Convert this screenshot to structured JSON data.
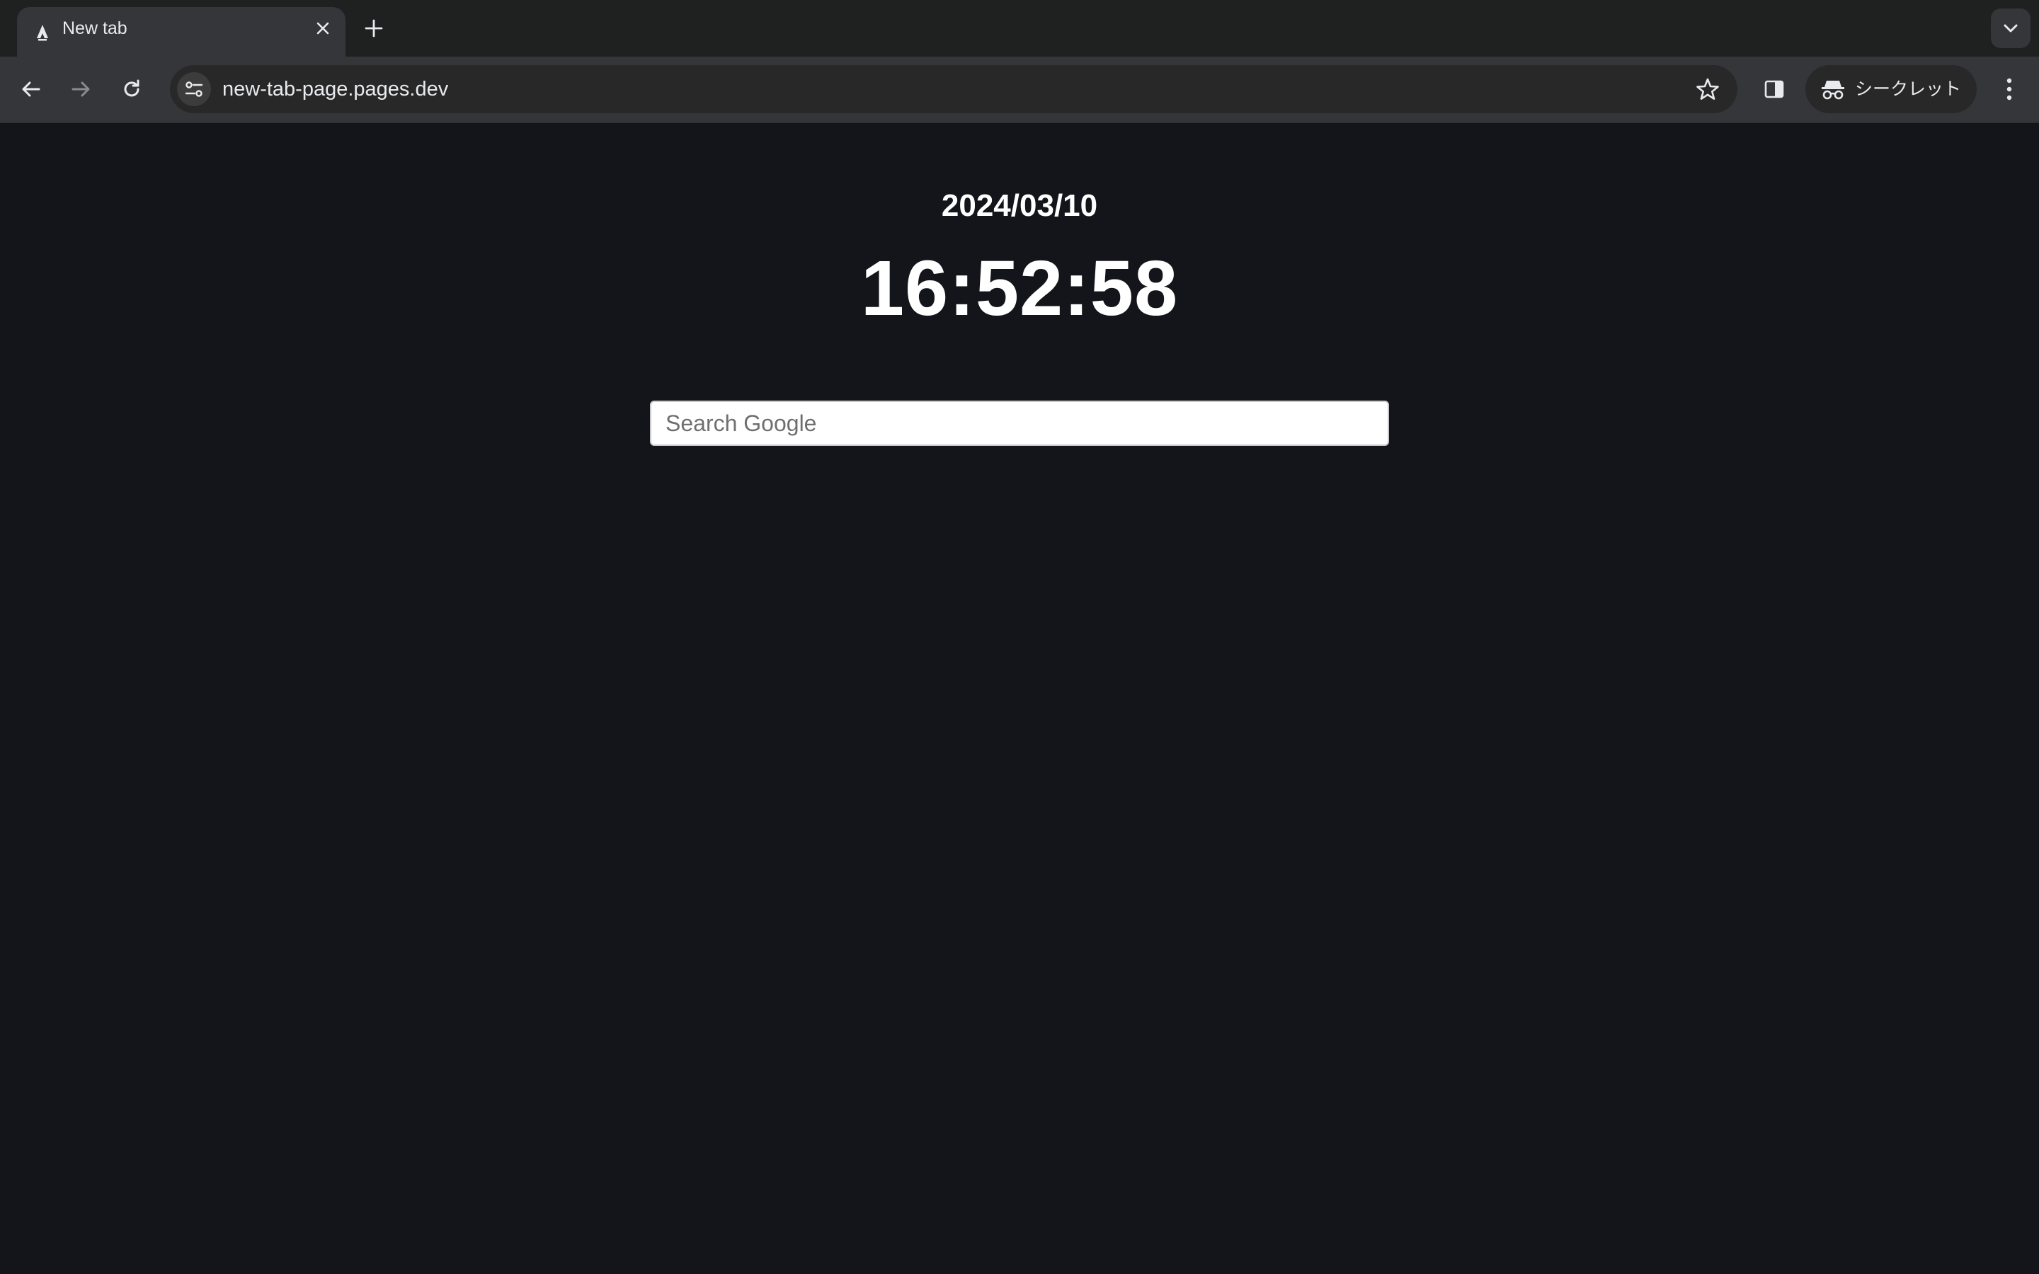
{
  "browser": {
    "tab": {
      "title": "New tab"
    },
    "address_bar": {
      "url": "new-tab-page.pages.dev"
    },
    "profile_chip": {
      "label": "シークレット"
    }
  },
  "page": {
    "date": "2024/03/10",
    "time": "16:52:58",
    "search": {
      "placeholder": "Search Google",
      "value": ""
    }
  },
  "colors": {
    "page_background": "#14151a",
    "toolbar": "#35363a",
    "tabstrip": "#1f2020",
    "text_light": "#e8eaed"
  },
  "icons": [
    "favicon-icon",
    "close-icon",
    "plus-icon",
    "chevron-down-icon",
    "back-arrow-icon",
    "forward-arrow-icon",
    "reload-icon",
    "site-settings-icon",
    "star-icon",
    "side-panel-icon",
    "incognito-icon",
    "more-vert-icon"
  ]
}
